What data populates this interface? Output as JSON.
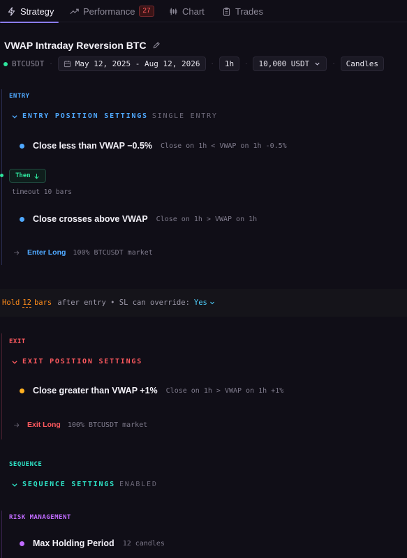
{
  "tabs": [
    {
      "label": "Strategy",
      "icon": "lightning-icon",
      "active": true
    },
    {
      "label": "Performance",
      "icon": "trend-icon",
      "badge": "27"
    },
    {
      "label": "Chart",
      "icon": "chart-icon"
    },
    {
      "label": "Trades",
      "icon": "clipboard-icon"
    }
  ],
  "strategy": {
    "title": "VWAP Intraday Reversion BTC",
    "symbol": "BTCUSDT",
    "date_range": "May 12, 2025 - Aug 12, 2026",
    "timeframe": "1h",
    "capital": "10,000 USDT",
    "data_type": "Candles"
  },
  "entry": {
    "section_label": "ENTRY",
    "settings_label": "ENTRY POSITION SETTINGS",
    "settings_sub": "SINGLE ENTRY",
    "condition1": {
      "title": "Close less than VWAP −0.5%",
      "desc": "Close on 1h < VWAP on 1h -0.5%"
    },
    "then_label": "Then",
    "timeout": "timeout 10 bars",
    "condition2": {
      "title": "Close crosses above VWAP",
      "desc": "Close on 1h > VWAP on 1h"
    },
    "action": {
      "label": "Enter Long",
      "desc": "100% BTCUSDT market"
    }
  },
  "hold": {
    "prefix": "Hold",
    "bars": "12",
    "unit": "bars",
    "text": "after entry • SL can override:",
    "override": "Yes"
  },
  "exit": {
    "section_label": "EXIT",
    "settings_label": "EXIT POSITION SETTINGS",
    "condition1": {
      "title": "Close greater than VWAP +1%",
      "desc": "Close on 1h > VWAP on 1h +1%"
    },
    "action": {
      "label": "Exit Long",
      "desc": "100% BTCUSDT market"
    }
  },
  "sequence": {
    "section_label": "SEQUENCE",
    "settings_label": "SEQUENCE SETTINGS",
    "settings_sub": "ENABLED"
  },
  "risk": {
    "section_label": "RISK MANAGEMENT",
    "item": {
      "title": "Max Holding Period",
      "desc": "12 candles"
    }
  },
  "colors": {
    "accent": "#8b7cf6",
    "entry_blue": "#4fa8ff",
    "live_green": "#2ee59d",
    "exit_red": "#ff5a5f",
    "hold_orange": "#ff8c1a",
    "exit_yellow": "#ffb020",
    "sequence_teal": "#2ee5c8",
    "risk_purple": "#c06bff"
  }
}
